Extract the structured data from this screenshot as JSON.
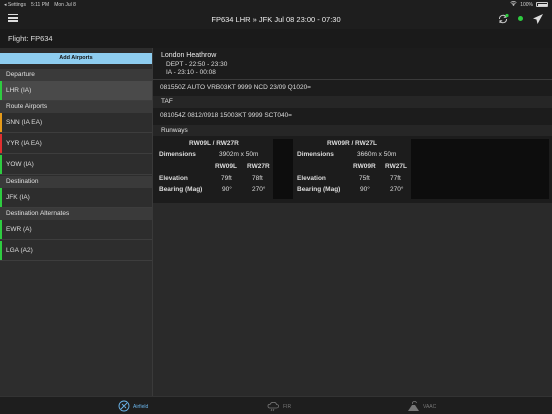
{
  "status": {
    "carrier": "◂ Settings",
    "time": "5:11 PM",
    "date": "Mon Jul 8",
    "battery": "100%"
  },
  "nav": {
    "title": "FP634   LHR » JFK   Jul 08 23:00 - 07:30"
  },
  "flight": {
    "label": "Flight: FP634"
  },
  "sidebar": {
    "add_label": "Add Airports",
    "sections": [
      {
        "header": "Departure",
        "rows": [
          {
            "label": "LHR (IA)",
            "color": "#2ecc40",
            "selected": true
          }
        ]
      },
      {
        "header": "Route Airports",
        "rows": [
          {
            "label": "SNN (IA EA)",
            "color": "#e69a1a"
          },
          {
            "label": "YYR (IA EA)",
            "color": "#e03030"
          },
          {
            "label": "YOW (IA)",
            "color": "#2ecc40"
          }
        ]
      },
      {
        "header": "Destination",
        "rows": [
          {
            "label": "JFK (IA)",
            "color": "#2ecc40"
          }
        ]
      },
      {
        "header": "Destination Alternates",
        "rows": [
          {
            "label": "EWR (A)",
            "color": "#2ecc40"
          },
          {
            "label": "LGA (A2)",
            "color": "#2ecc40"
          }
        ]
      }
    ]
  },
  "detail": {
    "airport": "London Heathrow",
    "dept": "DEPT - 22:50 - 23:30",
    "ia": "IA - 23:10 - 00:08",
    "metar": "081550Z AUTO VRB03KT 9999 NCD 23/09 Q1020=",
    "taf_header": "TAF",
    "taf": "081054Z 0812/0918 15003KT 9999 SCT040=",
    "runways_header": "Runways",
    "runways": [
      {
        "title": "RW09L / RW27R",
        "dim_label": "Dimensions",
        "dim": "3902m x 50m",
        "ends": [
          "RW09L",
          "RW27R"
        ],
        "elev_label": "Elevation",
        "elev": [
          "79ft",
          "78ft"
        ],
        "bearing_label": "Bearing (Mag)",
        "bearing": [
          "90°",
          "270°"
        ]
      },
      {
        "title": "RW09R / RW27L",
        "dim_label": "Dimensions",
        "dim": "3660m x 50m",
        "ends": [
          "RW09R",
          "RW27L"
        ],
        "elev_label": "Elevation",
        "elev": [
          "75ft",
          "77ft"
        ],
        "bearing_label": "Bearing (Mag)",
        "bearing": [
          "90°",
          "270°"
        ]
      }
    ]
  },
  "tabs": [
    {
      "label": "Airfield",
      "icon": "airfield-icon",
      "active": true
    },
    {
      "label": "FIR",
      "icon": "fir-icon",
      "active": false
    },
    {
      "label": "VAAC",
      "icon": "vaac-icon",
      "active": false
    }
  ]
}
